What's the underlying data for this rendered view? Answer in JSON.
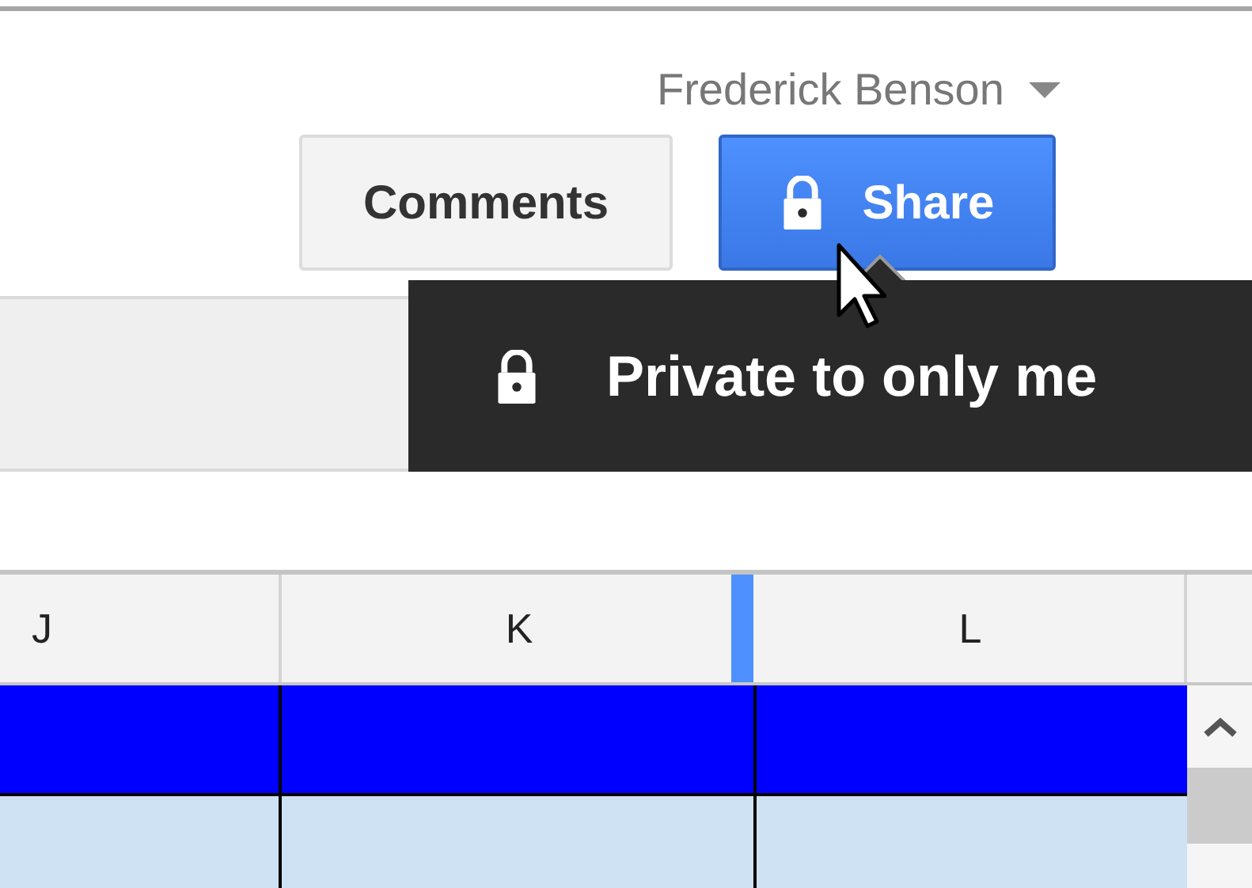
{
  "user": {
    "name": "Frederick Benson"
  },
  "buttons": [
    {
      "label": "Comments",
      "kind": "plain"
    },
    {
      "label": "Share",
      "kind": "primary"
    }
  ],
  "tooltip": {
    "text": "Private to only me"
  },
  "columns": [
    {
      "label": "J"
    },
    {
      "label": "K"
    },
    {
      "label": "L"
    }
  ],
  "rows": [
    {
      "color": "#0000ff"
    },
    {
      "color": "#cfe2f3"
    }
  ]
}
